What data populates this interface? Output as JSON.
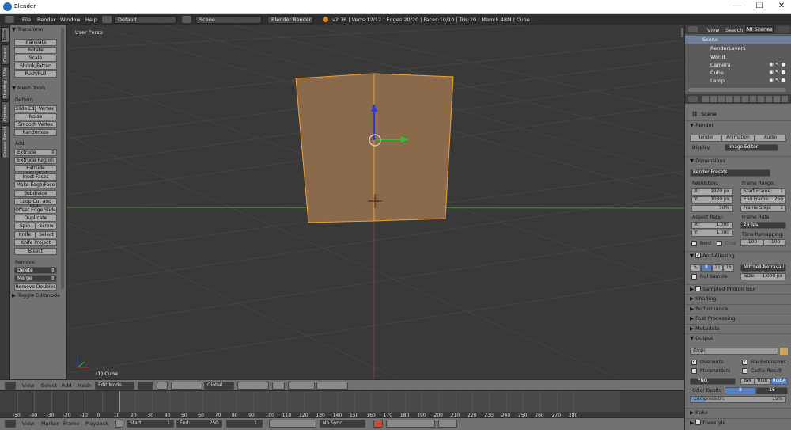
{
  "window": {
    "title": "Blender",
    "minimize": "—",
    "maximize": "☐",
    "close": "✕"
  },
  "menubar": {
    "items": [
      "File",
      "Render",
      "Window",
      "Help"
    ],
    "screen_layout": "Default",
    "scene": "Scene",
    "engine": "Blender Render",
    "stats": "v2.76 | Verts:12/12 | Edges:20/20 | Faces:10/10 | Tris:20 | Mem:8.48M | Cube"
  },
  "tool_tabs": [
    "Tools",
    "Create",
    "Shading / UVs",
    "Options",
    "Grease Pencil"
  ],
  "tool_shelf": {
    "transform_header": "Transform",
    "transform": [
      "Translate",
      "Rotate",
      "Scale",
      "Shrink/Fatten",
      "Push/Pull"
    ],
    "mesh_tools_header": "Mesh Tools",
    "deform_label": "Deform:",
    "slide_edge": "Slide Ed",
    "vertex": "Vertex",
    "noise": "Noise",
    "smooth_vertex": "Smooth Vertex",
    "randomize": "Randomize",
    "add_label": "Add:",
    "extrude": "Extrude",
    "add_items": [
      "Extrude Region",
      "Extrude Individual",
      "Inset Faces",
      "Make Edge/Face",
      "Subdivide",
      "Loop Cut and Slide",
      "Offset Edge Slide",
      "Duplicate"
    ],
    "spin": "Spin",
    "screw": "Screw",
    "knife": "Knife",
    "select": "Select",
    "knife_project": "Knife Project",
    "bisect": "Bisect",
    "remove_label": "Remove:",
    "delete": "Delete",
    "merge": "Merge",
    "remove_doubles": "Remove Doubles",
    "toggle_editmode": "Toggle Editmode"
  },
  "viewport": {
    "view_name": "User Persp",
    "object_label": "(1) Cube"
  },
  "view_header": {
    "menus": [
      "View",
      "Select",
      "Add",
      "Mesh"
    ],
    "mode": "Edit Mode",
    "orientation": "Global"
  },
  "timeline": {
    "ruler": [
      "-50",
      "-40",
      "-30",
      "-20",
      "-10",
      "0",
      "10",
      "20",
      "30",
      "40",
      "50",
      "60",
      "70",
      "80",
      "90",
      "100",
      "110",
      "120",
      "130",
      "140",
      "150",
      "160",
      "170",
      "180",
      "190",
      "200",
      "210",
      "220",
      "230",
      "240",
      "250",
      "260",
      "270",
      "280"
    ],
    "menus": [
      "View",
      "Marker",
      "Frame",
      "Playback"
    ],
    "start_label": "Start:",
    "start": "1",
    "end_label": "End:",
    "end": "250",
    "current": "1",
    "sync": "No Sync"
  },
  "outliner": {
    "tabs": [
      "View",
      "Search",
      "All Scenes"
    ],
    "items": [
      "Scene",
      "RenderLayers",
      "World",
      "Camera",
      "Cube",
      "Lamp"
    ]
  },
  "properties": {
    "context": "Scene",
    "render_header": "Render",
    "render_btn": "Render",
    "animation_btn": "Animation",
    "audio_btn": "Audio",
    "display_label": "Display:",
    "display_value": "Image Editor",
    "dimensions_header": "Dimensions",
    "render_presets": "Render Presets",
    "resolution_label": "Resolution:",
    "res_x_label": "X:",
    "res_x": "1920 px",
    "res_y_label": "Y:",
    "res_y": "1080 px",
    "res_pct": "50%",
    "frame_range_label": "Frame Range:",
    "start_frame_label": "Start Frame:",
    "start_frame": "1",
    "end_frame_label": "End Frame:",
    "end_frame": "250",
    "frame_step_label": "Frame Step:",
    "frame_step": "1",
    "aspect_label": "Aspect Ratio:",
    "asp_x_label": "X:",
    "asp_x": "1.000",
    "asp_y_label": "Y:",
    "asp_y": "1.000",
    "frame_rate_label": "Frame Rate:",
    "frame_rate": "24 fps",
    "time_remap_label": "Time Remapping:",
    "remap_old": ":100",
    "remap_new": ":100",
    "bord": "Bord",
    "crop": "Crop",
    "aa_header": "Anti-Aliasing",
    "aa_samples": [
      "5",
      "8",
      "11",
      "16"
    ],
    "aa_filter": "Mitchell-Netravali",
    "full_sample": "Full Sample",
    "size_label": "Size:",
    "size_value": "1.000 px",
    "motion_blur": "Sampled Motion Blur",
    "shading": "Shading",
    "performance": "Performance",
    "post_processing": "Post Processing",
    "metadata": "Metadata",
    "output_header": "Output",
    "output_path": "/tmp\\",
    "overwrite": "Overwrite",
    "file_extensions": "File Extensions",
    "placeholders": "Placeholders",
    "cache_result": "Cache Result",
    "format": "PNG",
    "color_modes": [
      "BW",
      "RGB",
      "RGBA"
    ],
    "color_depth_label": "Color Depth:",
    "color_depth": [
      "8",
      "16"
    ],
    "compression_label": "Compression:",
    "compression_value": "15%",
    "compression_fraction": 0.15,
    "bake": "Bake",
    "freestyle": "Freestyle"
  }
}
